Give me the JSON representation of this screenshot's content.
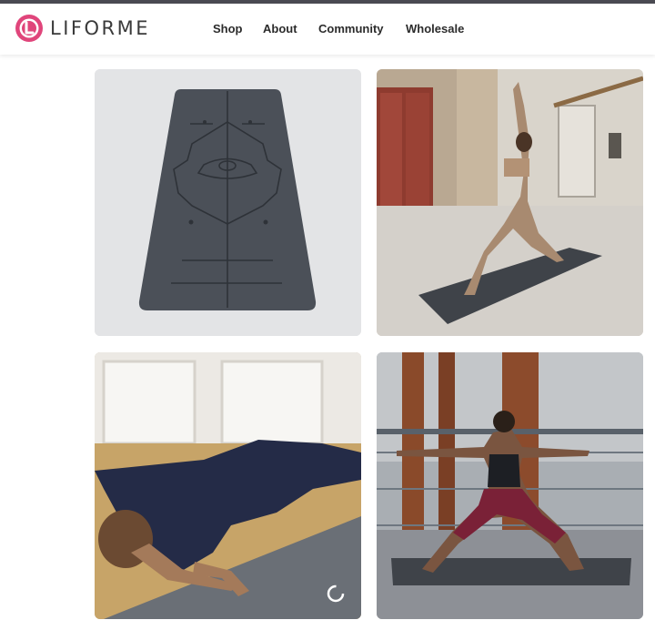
{
  "brand": {
    "name": "LIFORME",
    "logo_color": "#e0457b"
  },
  "nav": {
    "items": [
      "Shop",
      "About",
      "Community",
      "Wholesale"
    ]
  },
  "gallery": {
    "tiles": [
      {
        "subject": "grey yoga mat with alignment markers",
        "icon": "yoga-mat-image"
      },
      {
        "subject": "woman in warrior pose on mat in courtyard",
        "icon": "yoga-photo"
      },
      {
        "subject": "woman in arm balance pose on mat indoors",
        "icon": "yoga-photo"
      },
      {
        "subject": "woman in warrior II pose on rooftop",
        "icon": "yoga-photo"
      }
    ],
    "loading_indicator": "spinner"
  }
}
